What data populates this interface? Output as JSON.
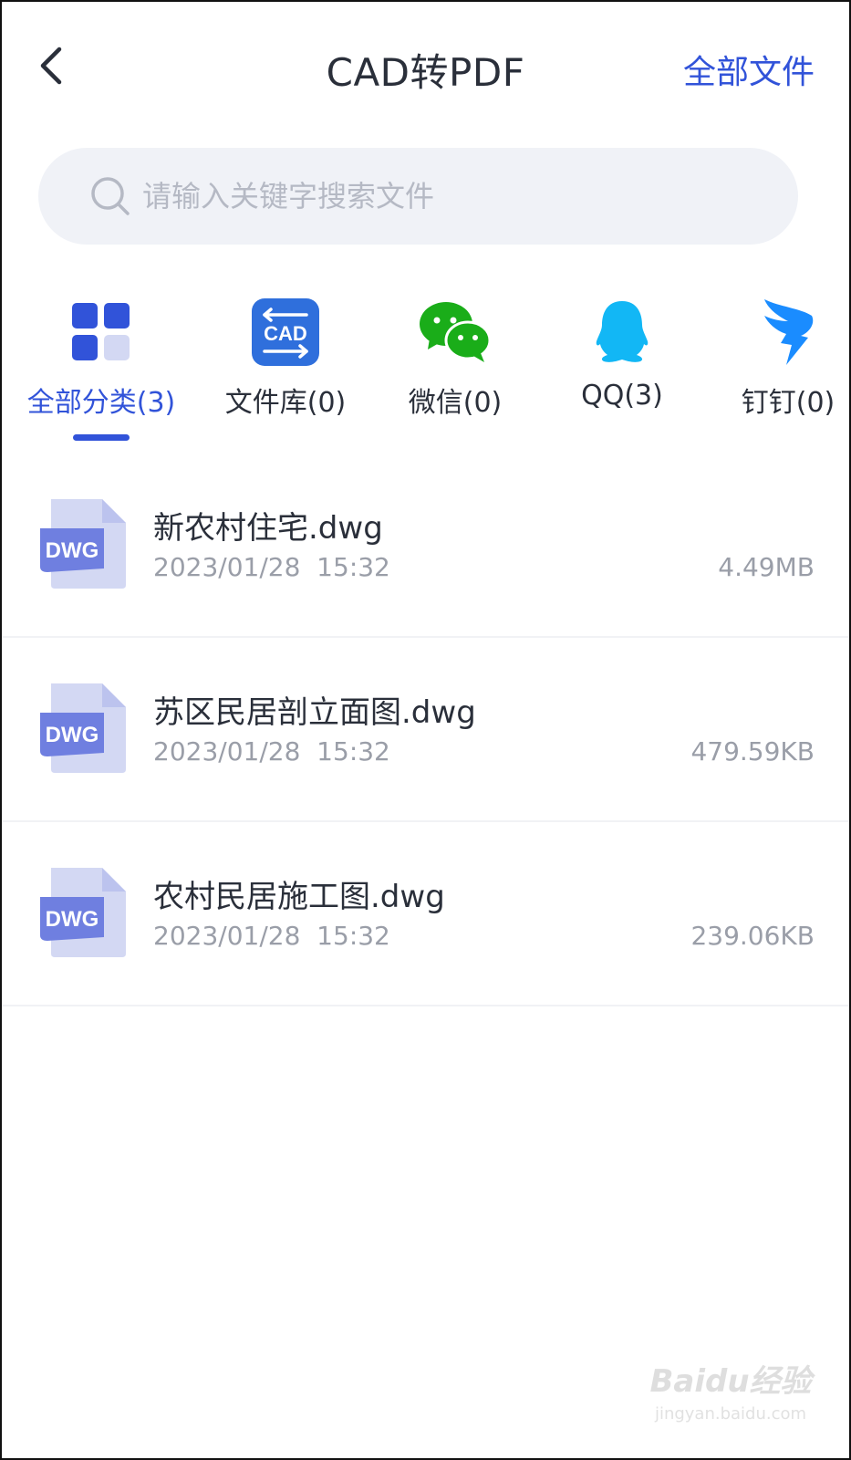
{
  "header": {
    "title": "CAD转PDF",
    "right_link": "全部文件",
    "back_icon": "chevron-left-icon"
  },
  "search": {
    "placeholder": "请输入关键字搜索文件",
    "value": ""
  },
  "tabs": [
    {
      "label": "全部分类(3)",
      "icon": "grid-icon",
      "active": true
    },
    {
      "label": "文件库(0)",
      "icon": "cad-icon",
      "active": false
    },
    {
      "label": "微信(0)",
      "icon": "wechat-icon",
      "active": false
    },
    {
      "label": "QQ(3)",
      "icon": "qq-icon",
      "active": false
    },
    {
      "label": "钉钉(0)",
      "icon": "dingtalk-icon",
      "active": false
    }
  ],
  "files": [
    {
      "name": "新农村住宅.dwg",
      "date": "2023/01/28  15:32",
      "size": "4.49MB",
      "type": "DWG"
    },
    {
      "name": "苏区民居剖立面图.dwg",
      "date": "2023/01/28  15:32",
      "size": "479.59KB",
      "type": "DWG"
    },
    {
      "name": "农村民居施工图.dwg",
      "date": "2023/01/28  15:32",
      "size": "239.06KB",
      "type": "DWG"
    }
  ],
  "cad_icon_text": "CAD",
  "colors": {
    "accent": "#3153d9",
    "wechat": "#1aad19",
    "qq": "#12b7f5",
    "dingtalk": "#1a8cff",
    "file_icon_light": "#d3d8f3",
    "file_icon_dark": "#6f7fe0"
  },
  "watermark": {
    "logo": "Baidu经验",
    "url": "jingyan.baidu.com"
  }
}
